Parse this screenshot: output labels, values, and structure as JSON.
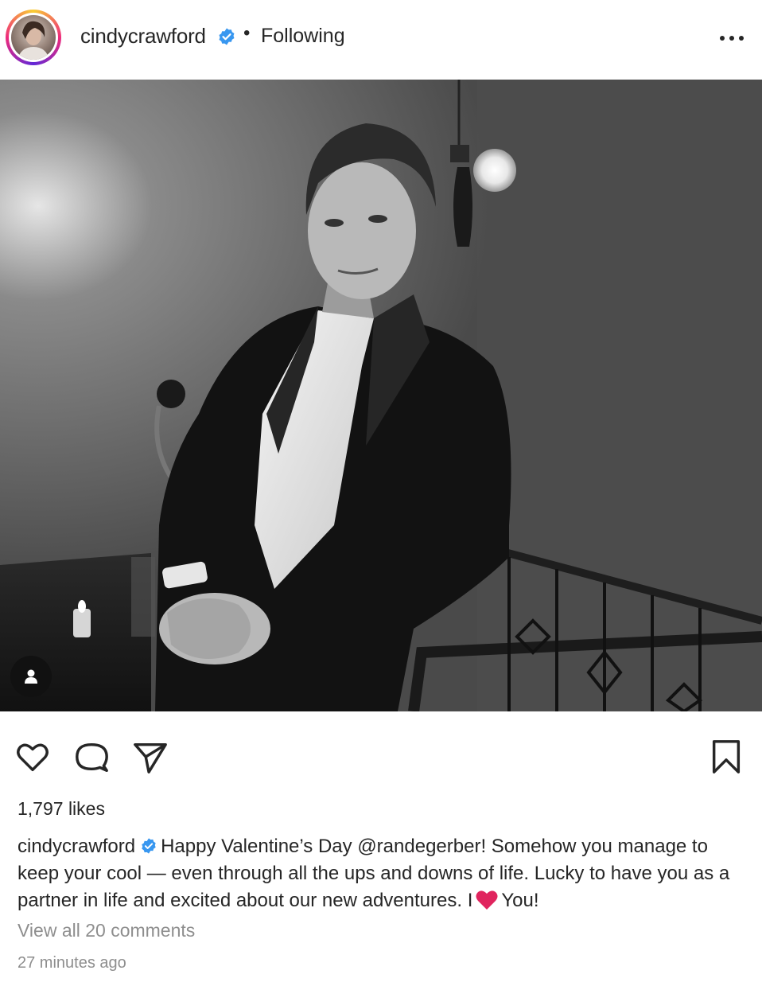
{
  "post": {
    "username": "cindycrawford",
    "separator": "•",
    "follow_status": "Following",
    "more_icon": "more-horizontal-icon",
    "likes": "1,797 likes",
    "caption": {
      "username": "cindycrawford",
      "text_before_heart": "Happy Valentine’s Day @randegerber! Somehow you manage to keep your cool — even through all the ups and downs of life. Lucky to have you as a partner in life and excited about our new adventures. I",
      "heart": "❤️",
      "text_after_heart": "You!"
    },
    "view_comments": "View all 20 comments",
    "timestamp": "27 minutes ago"
  },
  "actions": {
    "like_icon": "heart-outline-icon",
    "comment_icon": "comment-icon",
    "share_icon": "send-icon",
    "save_icon": "bookmark-icon"
  },
  "colors": {
    "verified": "#3897f0",
    "text": "#262626",
    "muted": "#8e8e8e",
    "heart": "#e0245e"
  }
}
